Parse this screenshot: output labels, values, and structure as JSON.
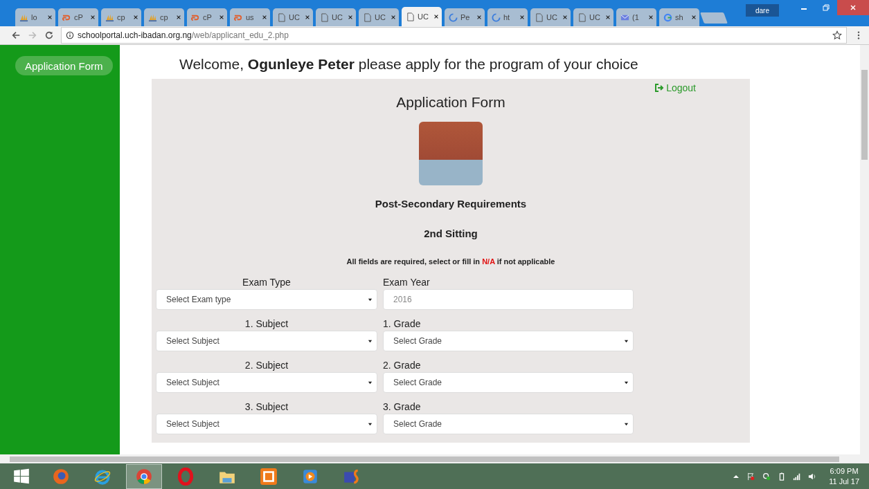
{
  "browser": {
    "tabs": [
      {
        "title": "lo",
        "kind": "pma",
        "selected": false
      },
      {
        "title": "cP",
        "kind": "cpanel",
        "selected": false
      },
      {
        "title": "cp",
        "kind": "pma",
        "selected": false
      },
      {
        "title": "cp",
        "kind": "pma",
        "selected": false
      },
      {
        "title": "cP",
        "kind": "cpanel",
        "selected": false
      },
      {
        "title": "us",
        "kind": "cpanel",
        "selected": false
      },
      {
        "title": "UC",
        "kind": "doc",
        "selected": false
      },
      {
        "title": "UC",
        "kind": "doc",
        "selected": false
      },
      {
        "title": "UC",
        "kind": "doc",
        "selected": false
      },
      {
        "title": "UC",
        "kind": "doc",
        "selected": true
      },
      {
        "title": "Pe",
        "kind": "spinner",
        "selected": false
      },
      {
        "title": "ht",
        "kind": "spinner",
        "selected": false
      },
      {
        "title": "UC",
        "kind": "doc",
        "selected": false
      },
      {
        "title": "UC",
        "kind": "doc",
        "selected": false
      },
      {
        "title": "(1",
        "kind": "mail",
        "selected": false
      },
      {
        "title": "sh",
        "kind": "google",
        "selected": false
      }
    ],
    "profile": "dare",
    "url_host": "schoolportal.uch-ibadan.org.ng",
    "url_path": "/web/applicant_edu_2.php"
  },
  "sidebar": {
    "button": "Application Form"
  },
  "page": {
    "welcome_prefix": "Welcome, ",
    "user_name": "Ogunleye Peter",
    "welcome_suffix": " please apply for the program of your choice",
    "logout": "Logout",
    "form_title": "Application Form",
    "section_title": "Post-Secondary Requirements",
    "sitting": "2nd Sitting",
    "notice": "All fields are required, select or fill in ",
    "notice_highlight": "N/A",
    "notice_suffix": " if not applicable",
    "rows": [
      {
        "left_label": "Exam Type",
        "left": {
          "kind": "select",
          "text": "Select Exam type"
        },
        "right_label": "Exam Year",
        "right": {
          "kind": "input",
          "text": "2016"
        }
      },
      {
        "left_label": "1. Subject",
        "left": {
          "kind": "select",
          "text": "Select Subject"
        },
        "right_label": "1. Grade",
        "right": {
          "kind": "select",
          "text": "Select Grade"
        }
      },
      {
        "left_label": "2. Subject",
        "left": {
          "kind": "select",
          "text": "Select Subject"
        },
        "right_label": "2. Grade",
        "right": {
          "kind": "select",
          "text": "Select Grade"
        }
      },
      {
        "left_label": "3. Subject",
        "left": {
          "kind": "select",
          "text": "Select Subject"
        },
        "right_label": "3. Grade",
        "right": {
          "kind": "select",
          "text": "Select Grade"
        }
      }
    ]
  },
  "taskbar": {
    "apps": [
      {
        "kind": "firefox",
        "selected": false
      },
      {
        "kind": "ie",
        "selected": false
      },
      {
        "kind": "chrome",
        "selected": true
      },
      {
        "kind": "opera",
        "selected": false
      },
      {
        "kind": "folder",
        "selected": false
      },
      {
        "kind": "xampp",
        "selected": false
      },
      {
        "kind": "media",
        "selected": false
      },
      {
        "kind": "phpstorm",
        "selected": false
      }
    ],
    "time": "6:09 PM",
    "date": "11 Jul 17"
  }
}
